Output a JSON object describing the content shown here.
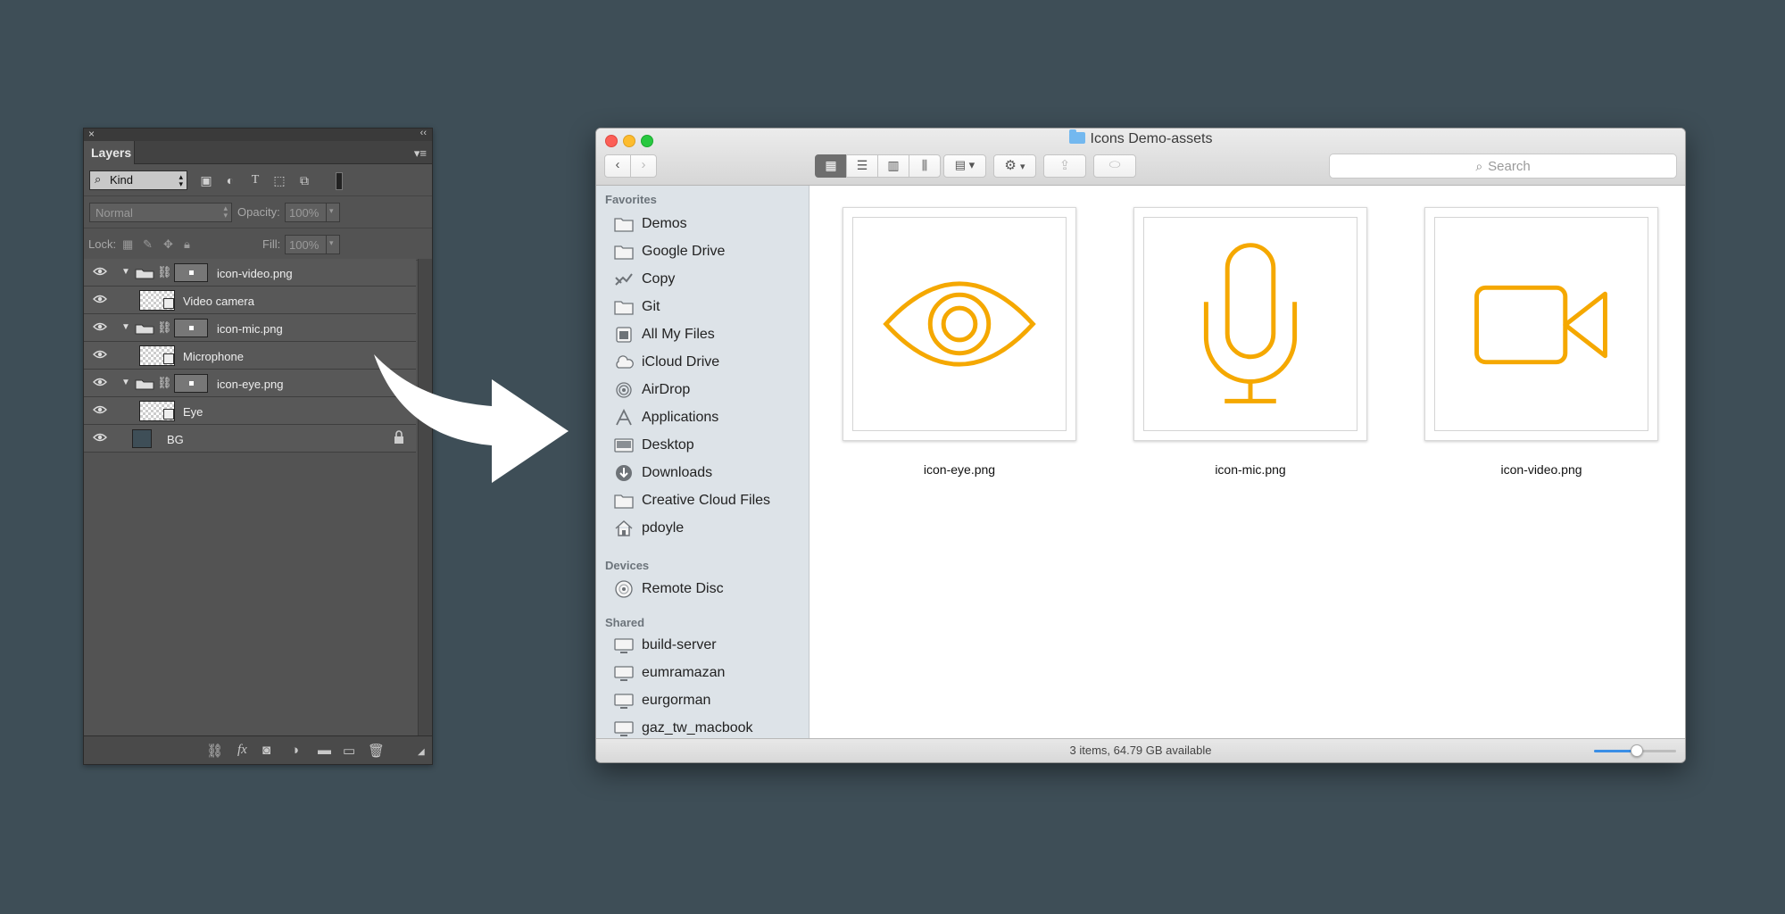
{
  "photoshop": {
    "panel_tab": "Layers",
    "filter_kind": "Kind",
    "blend_mode": "Normal",
    "opacity_label": "Opacity:",
    "opacity_value": "100%",
    "lock_label": "Lock:",
    "fill_label": "Fill:",
    "fill_value": "100%",
    "layers": [
      {
        "name": "icon-video.png",
        "type": "group"
      },
      {
        "name": "Video camera",
        "type": "smart"
      },
      {
        "name": "icon-mic.png",
        "type": "group"
      },
      {
        "name": "Microphone",
        "type": "smart"
      },
      {
        "name": "icon-eye.png",
        "type": "group"
      },
      {
        "name": "Eye",
        "type": "smart"
      },
      {
        "name": "BG",
        "type": "background"
      }
    ]
  },
  "finder": {
    "window_title": "Icons Demo-assets",
    "search_placeholder": "Search",
    "sidebar": {
      "favorites_label": "Favorites",
      "favorites": [
        {
          "label": "Demos",
          "icon": "folder-icon"
        },
        {
          "label": "Google Drive",
          "icon": "folder-icon"
        },
        {
          "label": "Copy",
          "icon": "copy-icon"
        },
        {
          "label": "Git",
          "icon": "folder-icon"
        },
        {
          "label": "All My Files",
          "icon": "all-files-icon"
        },
        {
          "label": "iCloud Drive",
          "icon": "cloud-icon"
        },
        {
          "label": "AirDrop",
          "icon": "airdrop-icon"
        },
        {
          "label": "Applications",
          "icon": "applications-icon"
        },
        {
          "label": "Desktop",
          "icon": "desktop-icon"
        },
        {
          "label": "Downloads",
          "icon": "downloads-icon"
        },
        {
          "label": "Creative Cloud Files",
          "icon": "folder-icon"
        },
        {
          "label": "pdoyle",
          "icon": "home-icon"
        }
      ],
      "devices_label": "Devices",
      "devices": [
        {
          "label": "Remote Disc",
          "icon": "disc-icon"
        }
      ],
      "shared_label": "Shared",
      "shared": [
        {
          "label": "build-server",
          "icon": "computer-icon"
        },
        {
          "label": "eumramazan",
          "icon": "computer-icon"
        },
        {
          "label": "eurgorman",
          "icon": "computer-icon"
        },
        {
          "label": "gaz_tw_macbook",
          "icon": "computer-icon"
        }
      ]
    },
    "files": [
      {
        "name": "icon-eye.png",
        "icon": "eye-icon"
      },
      {
        "name": "icon-mic.png",
        "icon": "microphone-icon"
      },
      {
        "name": "icon-video.png",
        "icon": "video-camera-icon"
      }
    ],
    "status_text": "3 items, 64.79 GB available",
    "zoom_level": 0.52,
    "colors": {
      "icon_accent": "#F5A800",
      "zoom_accent": "#3A8EE6"
    }
  }
}
